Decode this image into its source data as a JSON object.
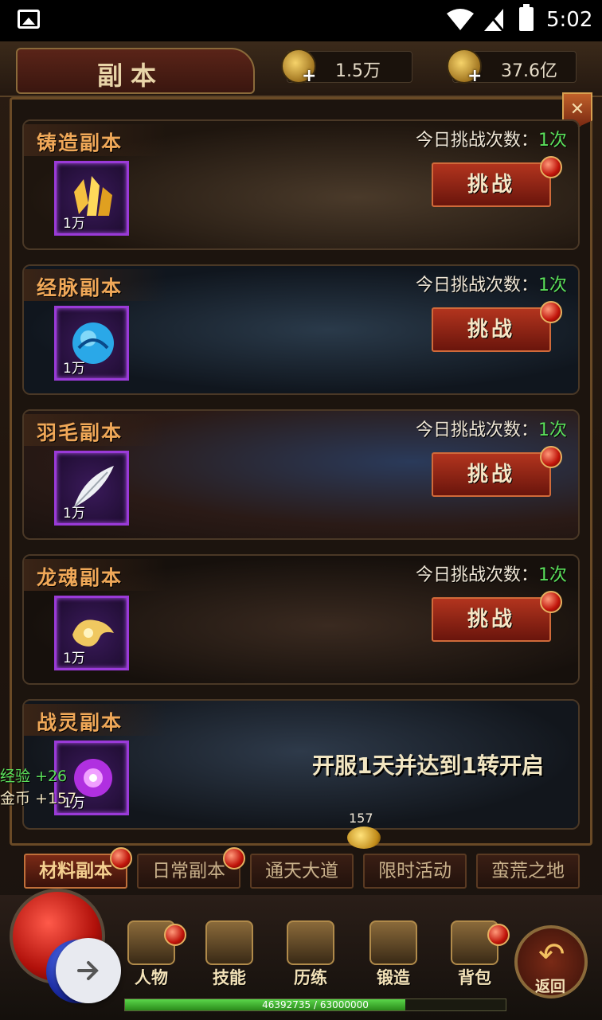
{
  "status_bar": {
    "time": "5:02"
  },
  "header": {
    "title": "副本",
    "currency_coins": "1.5万",
    "currency_ingots": "37.6亿"
  },
  "dungeons": [
    {
      "name": "铸造副本",
      "reward_qty": "1万",
      "attempts_label": "今日挑战次数：",
      "attempts_value": "1次",
      "button": "挑战",
      "icon": "gold-crystal-icon"
    },
    {
      "name": "经脉副本",
      "reward_qty": "1万",
      "attempts_label": "今日挑战次数：",
      "attempts_value": "1次",
      "button": "挑战",
      "icon": "blue-orb-icon"
    },
    {
      "name": "羽毛副本",
      "reward_qty": "1万",
      "attempts_label": "今日挑战次数：",
      "attempts_value": "1次",
      "button": "挑战",
      "icon": "feather-icon"
    },
    {
      "name": "龙魂副本",
      "reward_qty": "1万",
      "attempts_label": "今日挑战次数：",
      "attempts_value": "1次",
      "button": "挑战",
      "icon": "dragon-soul-icon"
    },
    {
      "name": "战灵副本",
      "reward_qty": "1万",
      "locked_text": "开服1天并达到1转开启",
      "icon": "purple-soul-icon"
    }
  ],
  "floating_gains": {
    "exp": "经验 +26",
    "gold": "金币 +157"
  },
  "loot": {
    "count": "157"
  },
  "tabs": [
    "材料副本",
    "日常副本",
    "通天大道",
    "限时活动",
    "蛮荒之地"
  ],
  "menu": [
    "人物",
    "技能",
    "历练",
    "锻造",
    "背包"
  ],
  "return_label": "返回",
  "xp": {
    "text": "46392735 / 63000000",
    "fraction": 0.736
  },
  "colors": {
    "accent_orange": "#f0a858",
    "attempt_green": "#5be05b",
    "button_red": "#b2341e",
    "item_frame_purple": "#9a3ad8"
  }
}
